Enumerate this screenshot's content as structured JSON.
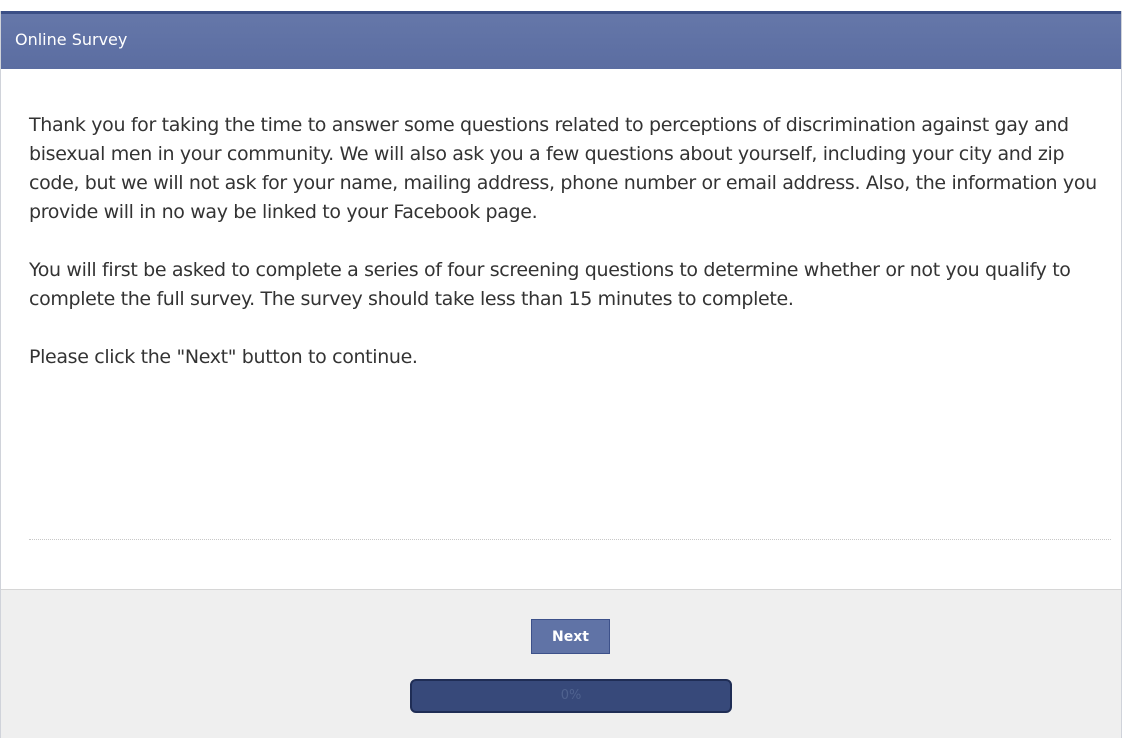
{
  "header": {
    "title": "Online Survey"
  },
  "intro": {
    "paragraphs": [
      "Thank you for taking the time to answer some questions related to perceptions of discrimination against gay and bisexual men in your community. We will also ask you a few questions about yourself, including your city and zip code, but we will not ask for your name, mailing address, phone number or email address. Also, the information you provide will in no way be linked to your Facebook page.",
      "You will first be asked to complete a series of four screening questions to determine whether or not you qualify to complete the full survey. The survey should take less than 15 minutes to complete.",
      "Please click the \"Next\" button to continue."
    ]
  },
  "footer": {
    "next_label": "Next",
    "progress": {
      "percent": 0,
      "label": "0%"
    }
  },
  "colors": {
    "header": "#6577a9",
    "button": "#6073a6",
    "progress_track": "#37497a",
    "footer_bg": "#efefef"
  }
}
